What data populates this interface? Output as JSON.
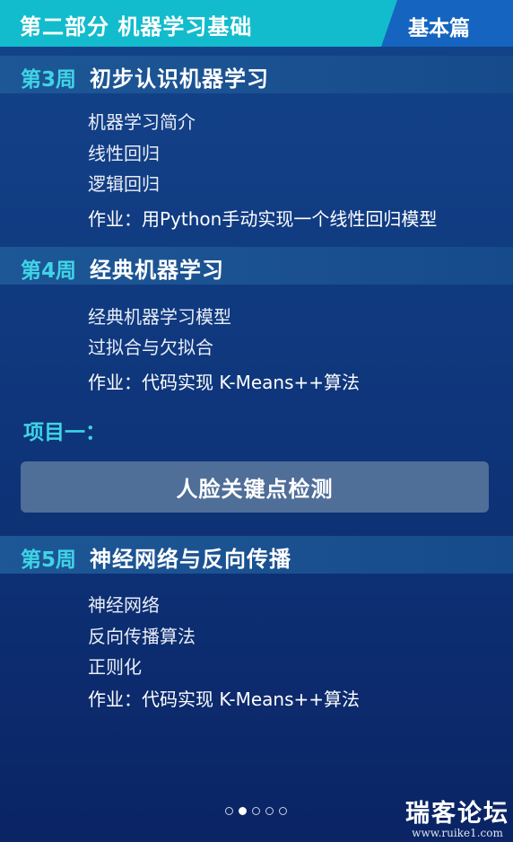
{
  "header": {
    "title": "第二部分 机器学习基础",
    "tag": "基本篇"
  },
  "weeks": [
    {
      "num": "第3周",
      "name": "初步认识机器学习",
      "items": [
        "机器学习简介",
        "线性回归",
        "逻辑回归"
      ],
      "homework": "作业：用Python手动实现一个线性回归模型"
    },
    {
      "num": "第4周",
      "name": "经典机器学习",
      "items": [
        "经典机器学习模型",
        "过拟合与欠拟合"
      ],
      "homework": "作业：代码实现 K-Means++算法"
    },
    {
      "num": "第5周",
      "name": "神经网络与反向传播",
      "items": [
        "神经网络",
        "反向传播算法",
        "正则化"
      ],
      "homework": "作业：代码实现 K-Means++算法"
    }
  ],
  "project": {
    "label": "项目一：",
    "title": "人脸关键点检测"
  },
  "pagination": {
    "total": 5,
    "active": 2
  },
  "watermark": {
    "name": "瑞客论坛",
    "url": "www.ruike1.com"
  }
}
